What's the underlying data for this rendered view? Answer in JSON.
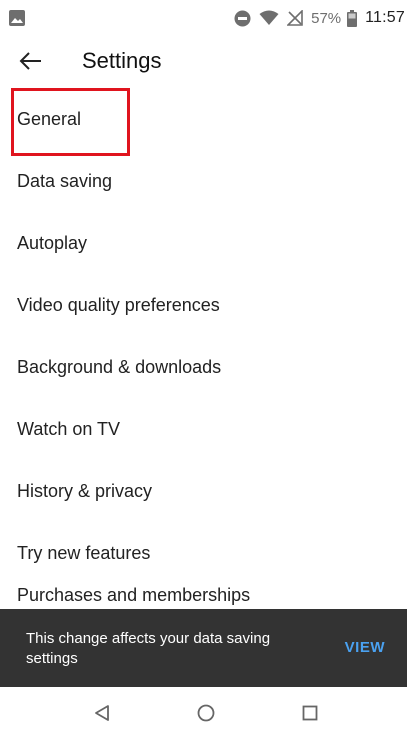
{
  "status_bar": {
    "battery_percent": "57%",
    "time": "11:57",
    "icons": [
      "image-icon",
      "do-not-disturb-icon",
      "wifi-icon",
      "no-signal-icon",
      "battery-icon"
    ]
  },
  "header": {
    "title": "Settings",
    "back_icon": "arrow-back-icon"
  },
  "settings": {
    "items": [
      {
        "label": "General"
      },
      {
        "label": "Data saving"
      },
      {
        "label": "Autoplay"
      },
      {
        "label": "Video quality preferences"
      },
      {
        "label": "Background & downloads"
      },
      {
        "label": "Watch on TV"
      },
      {
        "label": "History & privacy"
      },
      {
        "label": "Try new features"
      },
      {
        "label": "Purchases and memberships"
      }
    ],
    "highlight_color": "#e0141e"
  },
  "snackbar": {
    "message": "This change affects your data saving settings",
    "action": "VIEW",
    "action_color": "#4aa1f0"
  },
  "nav_bar": {
    "icons": [
      "back-triangle-icon",
      "home-circle-icon",
      "recents-square-icon"
    ]
  }
}
